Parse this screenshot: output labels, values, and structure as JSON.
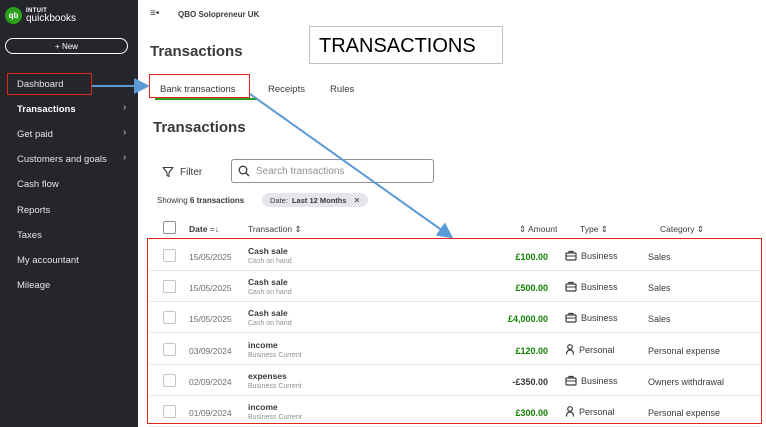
{
  "app": {
    "logo_mark": "qb",
    "logo_top": "INTUIT",
    "logo_bottom": "quickbooks",
    "company": "QBO Solopreneur UK",
    "menu_icon": "≡•"
  },
  "sidebar": {
    "new_label": "+ New",
    "items": [
      {
        "label": "Dashboard",
        "bold": false,
        "chevron": false
      },
      {
        "label": "Transactions",
        "bold": true,
        "chevron": true
      },
      {
        "label": "Get paid",
        "bold": false,
        "chevron": true
      },
      {
        "label": "Customers and goals",
        "bold": false,
        "chevron": true
      },
      {
        "label": "Cash flow",
        "bold": false,
        "chevron": false
      },
      {
        "label": "Reports",
        "bold": false,
        "chevron": false
      },
      {
        "label": "Taxes",
        "bold": false,
        "chevron": false
      },
      {
        "label": "My accountant",
        "bold": false,
        "chevron": false
      },
      {
        "label": "Mileage",
        "bold": false,
        "chevron": false
      }
    ]
  },
  "page": {
    "title": "Transactions",
    "callout": "TRANSACTIONS",
    "section_title": "Transactions"
  },
  "tabs": [
    {
      "label": "Bank transactions"
    },
    {
      "label": "Receipts"
    },
    {
      "label": "Rules"
    }
  ],
  "filter": {
    "label": "Filter",
    "search_placeholder": "Search transactions"
  },
  "showing": {
    "prefix": "Showing ",
    "count": "6 transactions"
  },
  "chip": {
    "label": "Date:",
    "value": "Last 12 Months",
    "close": "✕"
  },
  "table": {
    "headers": {
      "date": "Date",
      "sort_icon": "=↓",
      "transaction": "Transaction ⇕",
      "amount": "⇕ Amount",
      "type": "Type ⇕",
      "category": "Category ⇕"
    },
    "rows": [
      {
        "date": "15/05/2025",
        "name": "Cash sale",
        "sub": "Cash on hand",
        "amount": "£100.00",
        "type": "Business",
        "category": "Sales",
        "positive": true
      },
      {
        "date": "15/05/2025",
        "name": "Cash sale",
        "sub": "Cash on hand",
        "amount": "£500.00",
        "type": "Business",
        "category": "Sales",
        "positive": true
      },
      {
        "date": "15/05/2025",
        "name": "Cash sale",
        "sub": "Cash on hand",
        "amount": "£4,000.00",
        "type": "Business",
        "category": "Sales",
        "positive": true
      },
      {
        "date": "03/09/2024",
        "name": "income",
        "sub": "Business Current",
        "amount": "£120.00",
        "type": "Personal",
        "category": "Personal expense",
        "positive": true
      },
      {
        "date": "02/09/2024",
        "name": "expenses",
        "sub": "Business Current",
        "amount": "-£350.00",
        "type": "Business",
        "category": "Owners withdrawal",
        "positive": false
      },
      {
        "date": "01/09/2024",
        "name": "income",
        "sub": "Business Current",
        "amount": "£300.00",
        "type": "Personal",
        "category": "Personal expense",
        "positive": true
      }
    ]
  },
  "colors": {
    "sidebar_bg": "#24262b",
    "accent_green": "#2ca01c",
    "positive_amount": "#108000",
    "annotation_red": "#e2231a",
    "annotation_arrow": "#5b9bd5"
  }
}
